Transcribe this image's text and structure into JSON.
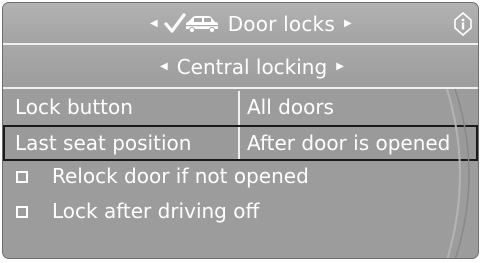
{
  "header": {
    "title": "Door locks",
    "left_arrow_icon": "triangle-left-icon",
    "right_arrow_icon": "triangle-right-icon",
    "title_icon": "car-check-icon",
    "info_icon": "info-icon"
  },
  "subheader": {
    "title": "Central locking"
  },
  "settings": [
    {
      "label": "Lock button",
      "value": "All doors"
    },
    {
      "label": "Last seat position",
      "value": "After door is opened"
    }
  ],
  "options": [
    {
      "label": "Relock door if not opened",
      "checked": false
    },
    {
      "label": "Lock after driving off",
      "checked": false
    }
  ],
  "colors": {
    "background": "#9c9c9c",
    "text": "#ffffff",
    "selection_border": "#1a1a1a"
  }
}
